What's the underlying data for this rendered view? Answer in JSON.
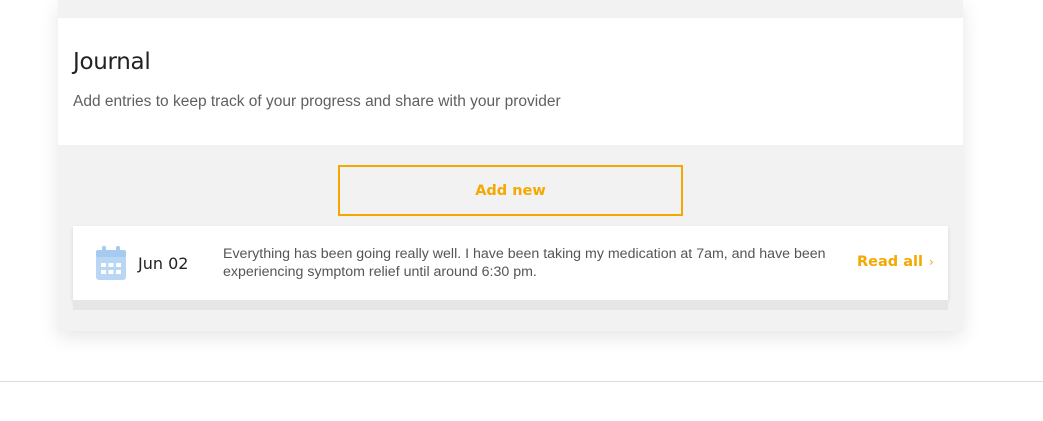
{
  "journal": {
    "title": "Journal",
    "subtitle": "Add entries to keep track of your progress and share with your provider",
    "add_button_label": "Add new"
  },
  "entries": [
    {
      "date": "Jun 02",
      "text": "Everything has been going really well. I have been taking my medication at 7am, and have been experiencing symptom relief until around 6:30 pm.",
      "read_all_label": "Read all",
      "icon": "calendar-icon",
      "chevron": "›"
    }
  ],
  "colors": {
    "accent": "#f5a800",
    "panel_bg": "#f2f2f2",
    "icon_blue": "#b9d7f5"
  }
}
